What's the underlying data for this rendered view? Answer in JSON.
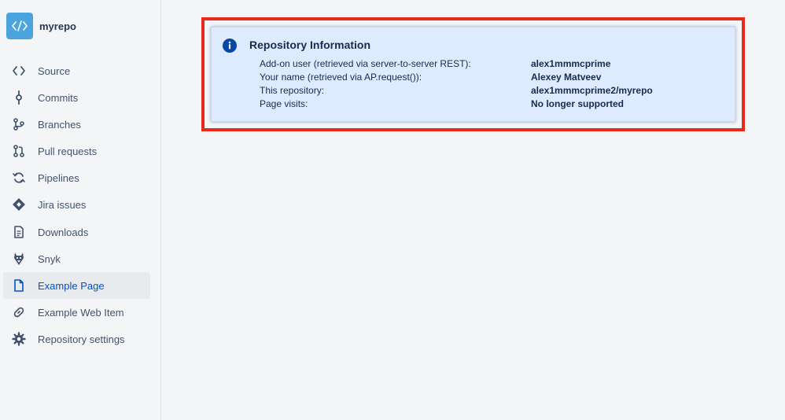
{
  "repo": {
    "name": "myrepo",
    "avatar_icon": "code-icon",
    "avatar_color": "#4ba4de"
  },
  "sidebar": {
    "items": [
      {
        "label": "Source",
        "icon": "source-icon"
      },
      {
        "label": "Commits",
        "icon": "commit-icon"
      },
      {
        "label": "Branches",
        "icon": "branch-icon"
      },
      {
        "label": "Pull requests",
        "icon": "pull-request-icon"
      },
      {
        "label": "Pipelines",
        "icon": "pipelines-icon"
      },
      {
        "label": "Jira issues",
        "icon": "jira-icon"
      },
      {
        "label": "Downloads",
        "icon": "file-icon"
      },
      {
        "label": "Snyk",
        "icon": "snyk-icon"
      },
      {
        "label": "Example Page",
        "icon": "page-icon",
        "active": true
      },
      {
        "label": "Example Web Item",
        "icon": "link-icon"
      },
      {
        "label": "Repository settings",
        "icon": "gear-icon"
      }
    ]
  },
  "panel": {
    "title": "Repository Information",
    "icon": "info-icon",
    "rows": [
      {
        "label": "Add-on user (retrieved via server-to-server REST):",
        "value": "alex1mmmcprime"
      },
      {
        "label": "Your name (retrieved via AP.request()):",
        "value": "Alexey Matveev"
      },
      {
        "label": "This repository:",
        "value": "alex1mmmcprime2/myrepo"
      },
      {
        "label": "Page visits:",
        "value": "No longer supported"
      }
    ]
  },
  "colors": {
    "highlight_border": "#e8291c",
    "panel_bg": "#deebff",
    "active_link": "#0052cc",
    "info_icon": "#0747a6"
  }
}
